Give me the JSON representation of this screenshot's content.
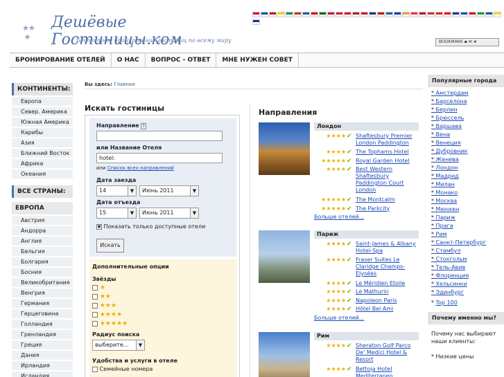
{
  "header": {
    "logo_title": "Дешёвые Гостиницы.ком",
    "logo_sub": "Бесплатное бронирование гостиниц по всему миру",
    "bookmark": "BOOKMARK"
  },
  "flag_colors": [
    "#cf142b",
    "#0055a4",
    "#c60b1e",
    "#ffce00",
    "#009246",
    "#d52b1e",
    "#0d5eaf",
    "#dd0000",
    "#006600",
    "#c8102e",
    "#dc143c",
    "#d7141a",
    "#ae1c28",
    "#ce1126",
    "#003580",
    "#cc0001",
    "#006aa7",
    "#0038b8",
    "#ff9933",
    "#ef3340",
    "#bc002d",
    "#cd2e3a",
    "#de2910",
    "#fe0000",
    "#003893",
    "#0052b4",
    "#d80027",
    "#009c3b",
    "#0057b7",
    "#ffd700",
    "#0039a6"
  ],
  "nav": [
    "БРОНИРОВАНИЕ ОТЕЛЕЙ",
    "О НАС",
    "ВОПРОС - ОТВЕТ",
    "МНЕ НУЖЕН СОВЕТ"
  ],
  "sidebar": {
    "continents_title": "КОНТИНЕНТЫ:",
    "continents": [
      "Европа",
      "Север. Америка",
      "Южная Америка",
      "Карибы",
      "Азия",
      "Ближний Восток",
      "Африка",
      "Океания"
    ],
    "countries_title": "ВСЕ СТРАНЫ:",
    "europe_title": "ЕВРОПА",
    "countries": [
      "Австрия",
      "Андорра",
      "Англия",
      "Бельгия",
      "Болгария",
      "Босния",
      "Великобритания",
      "Венгрия",
      "Германия",
      "Герцеговина",
      "Голландия",
      "Гренландия",
      "Греция",
      "Дания",
      "Ирландия",
      "Исландия"
    ]
  },
  "breadcrumb": {
    "prefix": "Вы здесь:",
    "current": "Главная"
  },
  "search": {
    "title": "Искать гостиницы",
    "direction_label": "Направление",
    "direction_value": "",
    "hotel_label": "или Название Отеля",
    "hotel_value": "hotel:",
    "list_prefix": "или",
    "list_link": "Список всех направлений",
    "checkin_label": "Дата заезда",
    "checkin_day": "14",
    "checkin_month": "Июнь 2011",
    "checkout_label": "Дата отъезда",
    "checkout_day": "15",
    "checkout_month": "Июнь 2011",
    "available_label": "Показать только доступные отели",
    "search_button": "Искать",
    "extra_title": "Дополнительные опции",
    "stars_title": "Звёзды",
    "radius_title": "Радиус поиска",
    "radius_value": "выберите...",
    "amenities_title": "Удобства и услуги в отеле",
    "amenity_1": "Семейные номера"
  },
  "directions": {
    "title": "Направления",
    "more": "Больше отелей...",
    "cities": [
      {
        "name": "Лондон",
        "hotels": [
          {
            "stars": 4,
            "lines": [
              "Shaftesbury Premier",
              "London Paddington"
            ]
          },
          {
            "stars": 4,
            "lines": [
              "The Tophams Hotel"
            ]
          },
          {
            "stars": 5,
            "lines": [
              "Royal Garden Hotel"
            ]
          },
          {
            "stars": 4,
            "lines": [
              "Best Western",
              "Shaftesbury",
              "Paddington Court",
              "London"
            ]
          },
          {
            "stars": 5,
            "lines": [
              "The Montcalm"
            ]
          },
          {
            "stars": 5,
            "lines": [
              "The Parkcity"
            ]
          }
        ]
      },
      {
        "name": "Париж",
        "hotels": [
          {
            "stars": 4,
            "lines": [
              "Saint-James & Albany",
              "Hotel-Spa"
            ]
          },
          {
            "stars": 4,
            "lines": [
              "Fraser Suites Le",
              "Claridge Champs-",
              "Elysées"
            ]
          },
          {
            "stars": 4,
            "lines": [
              "Le Méridien Etoile"
            ]
          },
          {
            "stars": 4,
            "lines": [
              "Le Mathurin"
            ]
          },
          {
            "stars": 4,
            "lines": [
              "Napoleon Paris"
            ]
          },
          {
            "stars": 4,
            "lines": [
              "Hôtel Bel Ami"
            ]
          }
        ]
      },
      {
        "name": "Рим",
        "hotels": [
          {
            "stars": 4,
            "lines": [
              "Sheraton Golf Parco",
              "De' Medici Hotel &",
              "Resort"
            ]
          },
          {
            "stars": 4,
            "lines": [
              "Bettoja Hotel",
              "Mediterraneo"
            ]
          }
        ]
      }
    ]
  },
  "right": {
    "popular_title": "Популярные города",
    "popular": [
      "Амстердам",
      "Барселона",
      "Берлин",
      "Брюссель",
      "Варшава",
      "Вена",
      "Венеция",
      "Дубровник",
      "Женева",
      "Лондон",
      "Мадрид",
      "Милан",
      "Монако",
      "Москва",
      "Мюнхен",
      "Париж",
      "Прага",
      "Рим",
      "Санкт-Петербург",
      "Стамбул",
      "Стокгольм",
      "Тель-Авив",
      "Флоренция",
      "Хельсинки",
      "Эдинбург"
    ],
    "top100": "Top 100",
    "why_title": "Почему именно мы?",
    "why_text": "Почему нас выбирают наши клиенты:",
    "why_item": "Низкие цены"
  }
}
